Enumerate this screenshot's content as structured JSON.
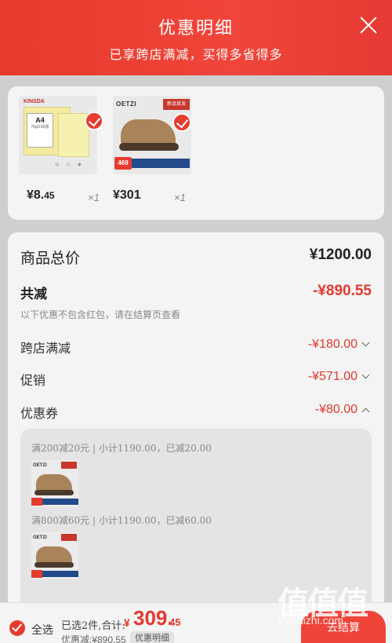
{
  "header": {
    "title": "优惠明细",
    "subtitle": "已享跨店满减，买得多省得多"
  },
  "products": [
    {
      "brand": "KINSDA",
      "label_main": "A4",
      "label_sub": "70g/100张",
      "price_main": "¥8.",
      "price_dec": "45",
      "qty": "×1",
      "icon_name": "paper-product"
    },
    {
      "brand": "OETZI",
      "badge": "469",
      "flag": "新品首发",
      "price_main": "¥301",
      "price_dec": "",
      "qty": "×1",
      "icon_name": "shoe-product"
    }
  ],
  "summary": {
    "total_label": "商品总价",
    "total_value": "¥1200.00",
    "reduce_label": "共减",
    "reduce_value": "-¥890.55",
    "note": "以下优惠不包含红包，请在结算页查看",
    "details": [
      {
        "label": "跨店满减",
        "value": "-¥180.00",
        "chevron": "down"
      },
      {
        "label": "促销",
        "value": "-¥571.00",
        "chevron": "down"
      },
      {
        "label": "优惠券",
        "value": "-¥80.00",
        "chevron": "up"
      }
    ]
  },
  "coupons": [
    {
      "rule": "满200减20元 | 小计1190.00，已减20.00"
    },
    {
      "rule": "满800减60元 | 小计1190.00，已减60.00"
    }
  ],
  "bottom": {
    "select_all": "全选",
    "selected_text": "已选2件,合计:",
    "pay_currency": "¥",
    "pay_main": "309.",
    "pay_dec": "45",
    "reduced_text": "优惠减:¥890.55",
    "detail_pill": "优惠明细",
    "checkout": "去结算"
  },
  "watermark": {
    "glyphs": "值值值",
    "site": "zhizhizhi.com"
  },
  "colors": {
    "accent": "#e63c30",
    "header": "#f0453a"
  }
}
